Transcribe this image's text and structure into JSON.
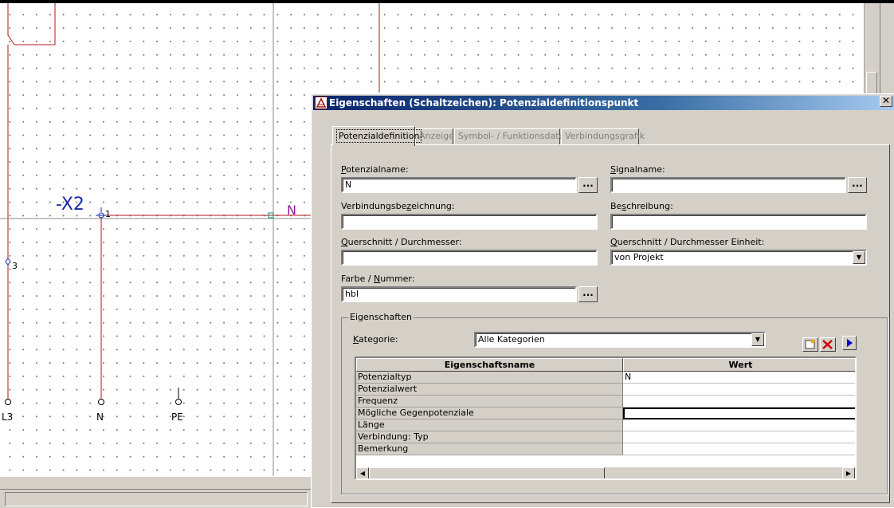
{
  "canvas": {
    "labels": {
      "device_tag": "-X2",
      "pin_1": "1",
      "potential_n": "N",
      "pin_3": "3",
      "terminal_l3": "L3",
      "terminal_n": "N",
      "terminal_pe": "PE"
    }
  },
  "dialog": {
    "title": "Eigenschaften (Schaltzeichen): Potenzialdefinitionspunkt",
    "close_glyph": "✕",
    "tabs": [
      {
        "label": "Potenzialdefinition",
        "active": true
      },
      {
        "label": "Anzeige",
        "active": false
      },
      {
        "label": "Symbol- / Funktionsdaten",
        "active": false
      },
      {
        "label": "Verbindungsgrafik",
        "active": false
      }
    ],
    "fields": {
      "potenzialname": {
        "label_pre": "",
        "label_u": "P",
        "label_post": "otenzialname:",
        "value": "N"
      },
      "signalname": {
        "label_pre": "",
        "label_u": "S",
        "label_post": "ignalname:",
        "value": ""
      },
      "verbindungsbezeichnung": {
        "label_pre": "Verbindungsbe",
        "label_u": "z",
        "label_post": "eichnung:",
        "value": ""
      },
      "beschreibung": {
        "label_pre": "Be",
        "label_u": "s",
        "label_post": "chreibung:",
        "value": ""
      },
      "querschnitt": {
        "label_pre": "",
        "label_u": "Q",
        "label_post": "uerschnitt / Durchmesser:",
        "value": ""
      },
      "querschnitt_einheit": {
        "label_pre": "",
        "label_u": "Q",
        "label_post": "uerschnitt / Durchmesser Einheit:",
        "value": "von Projekt"
      },
      "farbe": {
        "label_pre": "Farbe / ",
        "label_u": "N",
        "label_post": "ummer:",
        "value": "hbl"
      }
    },
    "browse_label": "...",
    "properties": {
      "group_title": "Eigenschaften",
      "kategorie_label_u": "K",
      "kategorie_label_post": "ategorie:",
      "kategorie_value": "Alle Kategorien",
      "columns": [
        "Eigenschaftsname",
        "Wert"
      ],
      "rows": [
        {
          "name": "Potenzialtyp",
          "value": "N"
        },
        {
          "name": "Potenzialwert",
          "value": ""
        },
        {
          "name": "Frequenz",
          "value": ""
        },
        {
          "name": "Mögliche Gegenpotenziale",
          "value": ""
        },
        {
          "name": "Länge",
          "value": ""
        },
        {
          "name": "Verbindung: Typ",
          "value": ""
        },
        {
          "name": "Bemerkung",
          "value": ""
        }
      ],
      "icons": {
        "new": "new-icon",
        "delete": "delete-icon",
        "move": "arrow-right-icon"
      },
      "colors": {
        "delete": "#cc0000",
        "move": "#0000cc"
      }
    }
  }
}
